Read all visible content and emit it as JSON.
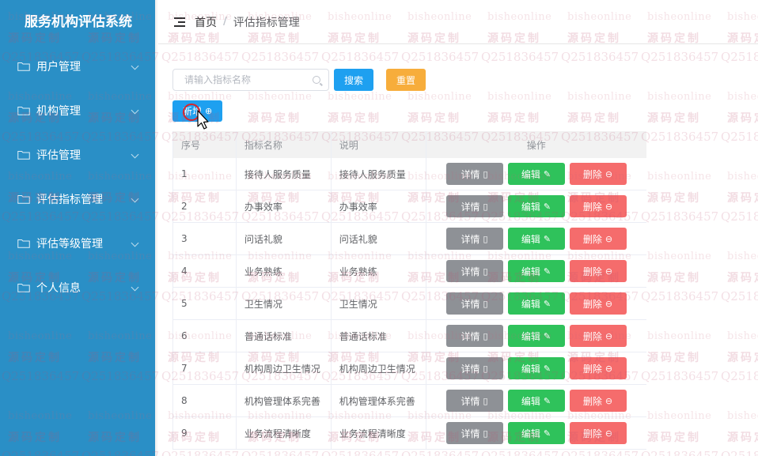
{
  "sidebar": {
    "title": "服务机构评估系统",
    "items": [
      {
        "label": "用户管理",
        "icon": "folder-icon"
      },
      {
        "label": "机构管理",
        "icon": "folder-icon"
      },
      {
        "label": "评估管理",
        "icon": "folder-icon"
      },
      {
        "label": "评估指标管理",
        "icon": "folder-icon"
      },
      {
        "label": "评估等级管理",
        "icon": "folder-icon"
      },
      {
        "label": "个人信息",
        "icon": "folder-icon"
      }
    ]
  },
  "header": {
    "breadcrumb_home": "首页",
    "breadcrumb_sep": "/",
    "breadcrumb_current": "评估指标管理"
  },
  "toolbar": {
    "search_placeholder": "请输入指标名称",
    "search_button": "搜索",
    "reset_button": "重置",
    "add_button": "新增"
  },
  "table": {
    "headers": {
      "index": "序号",
      "name": "指标名称",
      "desc": "说明",
      "actions": "操作"
    },
    "actions": {
      "detail": "详情",
      "edit": "编辑",
      "delete": "删除"
    },
    "rows": [
      {
        "index": "1",
        "name": "接待人服务质量",
        "desc": "接待人服务质量"
      },
      {
        "index": "2",
        "name": "办事效率",
        "desc": "办事效率"
      },
      {
        "index": "3",
        "name": "问话礼貌",
        "desc": "问话礼貌"
      },
      {
        "index": "4",
        "name": "业务熟练",
        "desc": "业务熟练"
      },
      {
        "index": "5",
        "name": "卫生情况",
        "desc": "卫生情况"
      },
      {
        "index": "6",
        "name": "普通话标准",
        "desc": "普通话标准"
      },
      {
        "index": "7",
        "name": "机构周边卫生情况",
        "desc": "机构周边卫生情况"
      },
      {
        "index": "8",
        "name": "机构管理体系完善",
        "desc": "机构管理体系完善"
      },
      {
        "index": "9",
        "name": "业务流程清晰度",
        "desc": "业务流程清晰度"
      }
    ]
  },
  "watermark": {
    "line_a": "bisheonline",
    "line_b": "源码定制",
    "line_c": "Q251836457"
  },
  "colors": {
    "sidebar_bg": "#2a8fc6",
    "primary": "#1ea0f0",
    "warning": "#f7ad3b",
    "success": "#2fc25b",
    "danger": "#f56c6c",
    "info": "#8e9196"
  }
}
